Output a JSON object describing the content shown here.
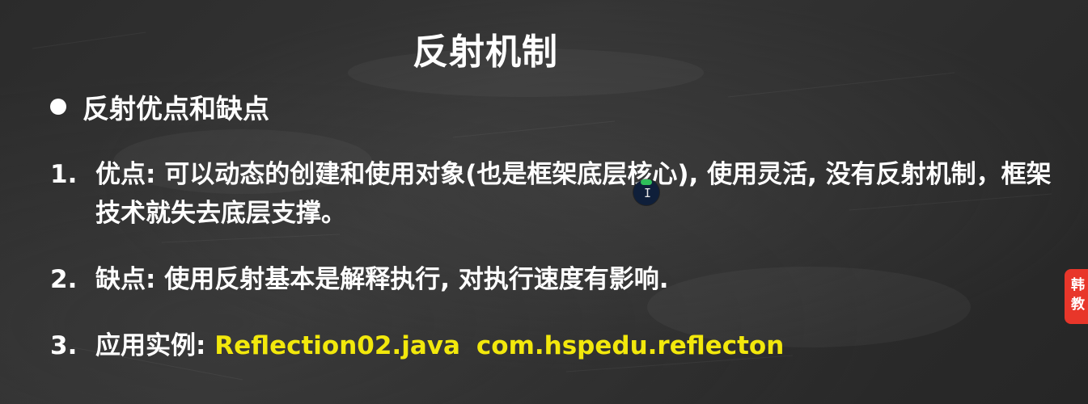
{
  "slide": {
    "title": "反射机制",
    "bullet_heading": "反射优点和缺点",
    "items": [
      {
        "num": "1.",
        "text": "优点: 可以动态的创建和使用对象(也是框架底层核心), 使用灵活, 没有反射机制，框架技术就失去底层支撑。"
      },
      {
        "num": "2.",
        "text": "缺点: 使用反射基本是解释执行, 对执行速度有影响."
      },
      {
        "num": "3.",
        "label": "应用实例:",
        "file": "Reflection02.java",
        "package": "com.hspedu.reflecton"
      }
    ]
  },
  "side_tab": {
    "line1": "韩",
    "line2": "教"
  },
  "cursor": {
    "icon": "text-cursor-icon"
  },
  "colors": {
    "background": "#2e2e2e",
    "text": "#ffffff",
    "highlight": "#f2e80c",
    "side_tab": "#e8362a"
  }
}
